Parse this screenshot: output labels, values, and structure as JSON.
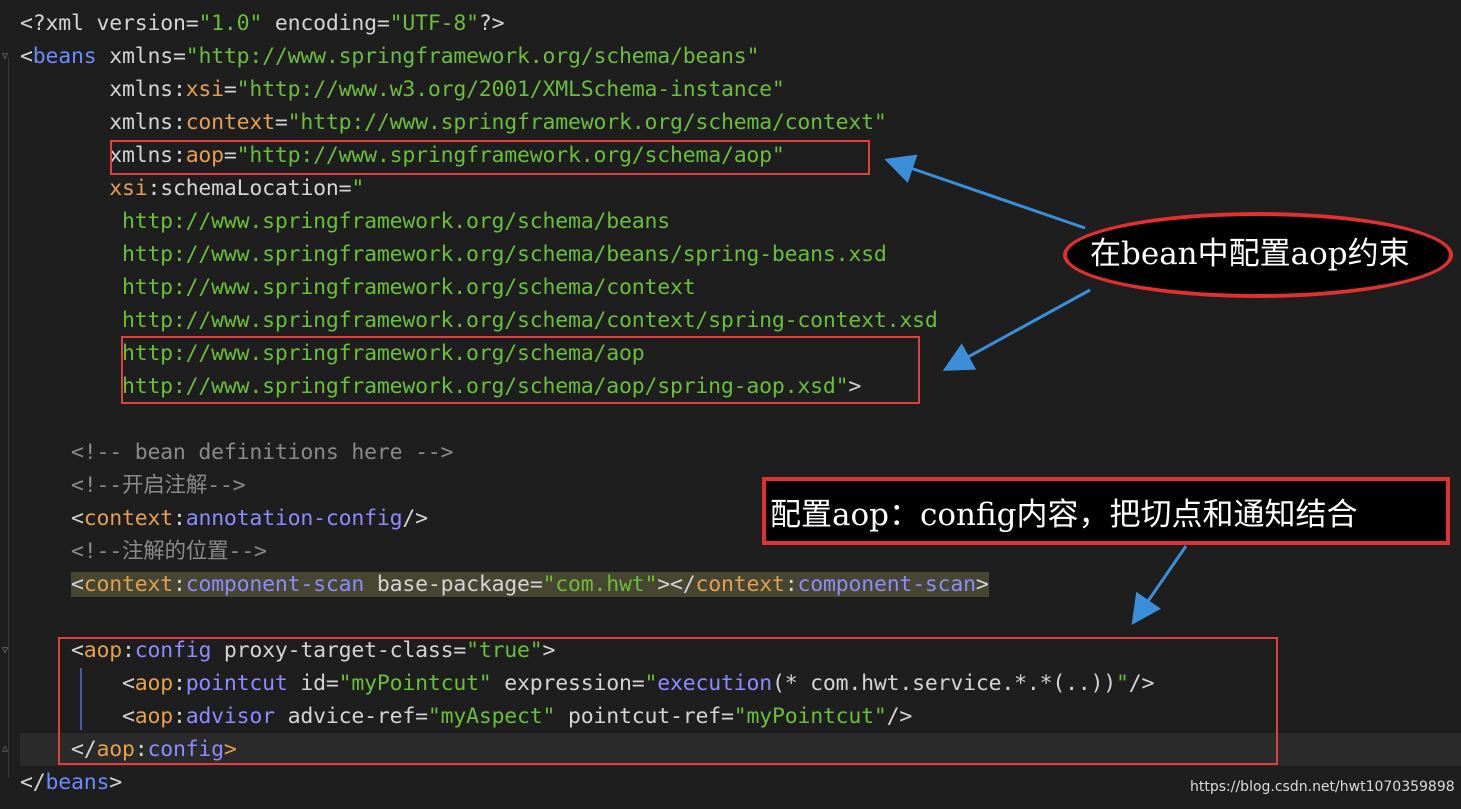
{
  "lines": [
    {
      "segments": [
        [
          "p",
          "<?"
        ],
        [
          "a",
          "xml version"
        ],
        [
          "p",
          "="
        ],
        [
          "s",
          "\"1.0\""
        ],
        [
          "a",
          " encoding"
        ],
        [
          "p",
          "="
        ],
        [
          "s",
          "\"UTF-8\""
        ],
        [
          "p",
          "?>"
        ]
      ]
    },
    {
      "segments": [
        [
          "p",
          "<"
        ],
        [
          "t",
          "beans"
        ],
        [
          "a",
          " xmlns"
        ],
        [
          "p",
          "="
        ],
        [
          "s",
          "\"http://www.springframework.org/schema/beans\""
        ]
      ]
    },
    {
      "segments": [
        [
          "a",
          "       xmlns"
        ],
        [
          "p",
          ":"
        ],
        [
          "n",
          "xsi"
        ],
        [
          "p",
          "="
        ],
        [
          "s",
          "\"http://www.w3.org/2001/XMLSchema-instance\""
        ]
      ]
    },
    {
      "segments": [
        [
          "a",
          "       xmlns"
        ],
        [
          "p",
          ":"
        ],
        [
          "n",
          "context"
        ],
        [
          "p",
          "="
        ],
        [
          "s",
          "\"http://www.springframework.org/schema/context\""
        ]
      ]
    },
    {
      "segments": [
        [
          "a",
          "       xmlns"
        ],
        [
          "p",
          ":"
        ],
        [
          "n",
          "aop"
        ],
        [
          "p",
          "="
        ],
        [
          "s",
          "\"http://www.springframework.org/schema/aop\""
        ]
      ]
    },
    {
      "segments": [
        [
          "n",
          "       xsi"
        ],
        [
          "p",
          ":"
        ],
        [
          "a",
          "schemaLocation"
        ],
        [
          "p",
          "="
        ],
        [
          "s",
          "\""
        ]
      ]
    },
    {
      "segments": [
        [
          "s",
          "        http://www.springframework.org/schema/beans"
        ]
      ]
    },
    {
      "segments": [
        [
          "s",
          "        http://www.springframework.org/schema/beans/spring-beans.xsd"
        ]
      ]
    },
    {
      "segments": [
        [
          "s",
          "        http://www.springframework.org/schema/context"
        ]
      ]
    },
    {
      "segments": [
        [
          "s",
          "        http://www.springframework.org/schema/context/spring-context.xsd"
        ]
      ]
    },
    {
      "segments": [
        [
          "s",
          "        http://www.springframework.org/schema/aop"
        ]
      ]
    },
    {
      "segments": [
        [
          "s",
          "        http://www.springframework.org/schema/aop/spring-aop.xsd\""
        ],
        [
          "p",
          ">"
        ]
      ]
    },
    {
      "segments": []
    },
    {
      "segments": [
        [
          "c",
          "    <!-- bean definitions here -->"
        ]
      ]
    },
    {
      "segments": [
        [
          "c",
          "    <!--开启注解-->"
        ]
      ]
    },
    {
      "segments": [
        [
          "p",
          "    <"
        ],
        [
          "n",
          "context"
        ],
        [
          "p",
          ":"
        ],
        [
          "l",
          "annotation-config"
        ],
        [
          "p",
          "/>"
        ]
      ]
    },
    {
      "segments": [
        [
          "c",
          "    <!--注解的位置-->"
        ]
      ]
    },
    {
      "bg": "scan",
      "segments": [
        [
          "p",
          "    "
        ],
        [
          "p",
          "<"
        ],
        [
          "n",
          "context"
        ],
        [
          "p",
          ":"
        ],
        [
          "l",
          "component-scan"
        ],
        [
          "a",
          " base-package"
        ],
        [
          "p",
          "="
        ],
        [
          "s",
          "\"com.hwt\""
        ],
        [
          "p",
          ">"
        ],
        [
          "p",
          "</"
        ],
        [
          "n",
          "context"
        ],
        [
          "p",
          ":"
        ],
        [
          "l",
          "component-scan"
        ],
        [
          "p",
          ">"
        ]
      ]
    },
    {
      "segments": []
    },
    {
      "segments": [
        [
          "p",
          "    <"
        ],
        [
          "n",
          "aop"
        ],
        [
          "p",
          ":"
        ],
        [
          "l",
          "config"
        ],
        [
          "a",
          " proxy-target-class"
        ],
        [
          "p",
          "="
        ],
        [
          "s",
          "\"true\""
        ],
        [
          "p",
          ">"
        ]
      ]
    },
    {
      "segments": [
        [
          "p",
          "        <"
        ],
        [
          "n",
          "aop"
        ],
        [
          "p",
          ":"
        ],
        [
          "l",
          "pointcut"
        ],
        [
          "a",
          " id"
        ],
        [
          "p",
          "="
        ],
        [
          "s",
          "\"myPointcut\""
        ],
        [
          "a",
          " expression"
        ],
        [
          "p",
          "="
        ],
        [
          "s",
          "\""
        ],
        [
          "l",
          "execution"
        ],
        [
          "p",
          "(* com.hwt.service.*.*(..))"
        ],
        [
          "s",
          "\""
        ],
        [
          "p",
          "/>"
        ]
      ]
    },
    {
      "segments": [
        [
          "p",
          "        <"
        ],
        [
          "n",
          "aop"
        ],
        [
          "p",
          ":"
        ],
        [
          "l",
          "advisor"
        ],
        [
          "a",
          " advice-ref"
        ],
        [
          "p",
          "="
        ],
        [
          "s",
          "\"myAspect\""
        ],
        [
          "a",
          " pointcut-ref"
        ],
        [
          "p",
          "="
        ],
        [
          "s",
          "\"myPointcut\""
        ],
        [
          "p",
          "/>"
        ]
      ]
    },
    {
      "segments": [
        [
          "p",
          "    </"
        ],
        [
          "n",
          "aop"
        ],
        [
          "p",
          ":"
        ],
        [
          "l",
          "config"
        ],
        [
          "n",
          ">"
        ]
      ]
    },
    {
      "segments": [
        [
          "p",
          "</"
        ],
        [
          "t",
          "beans"
        ],
        [
          "p",
          ">"
        ]
      ]
    }
  ],
  "annotations": {
    "bean_constraint": "在bean中配置aop约束",
    "aop_config": "配置aop：config内容，把切点和通知结合"
  },
  "watermark": "https://blog.csdn.net/hwt1070359898",
  "colors": {
    "background": "#1e1e1e",
    "tag": "#6b8cff",
    "namespace": "#e3a04f",
    "string": "#6abe3a",
    "comment": "#8a8a8a",
    "highlight_box": "#e04040",
    "arrow": "#3b8fd8"
  }
}
